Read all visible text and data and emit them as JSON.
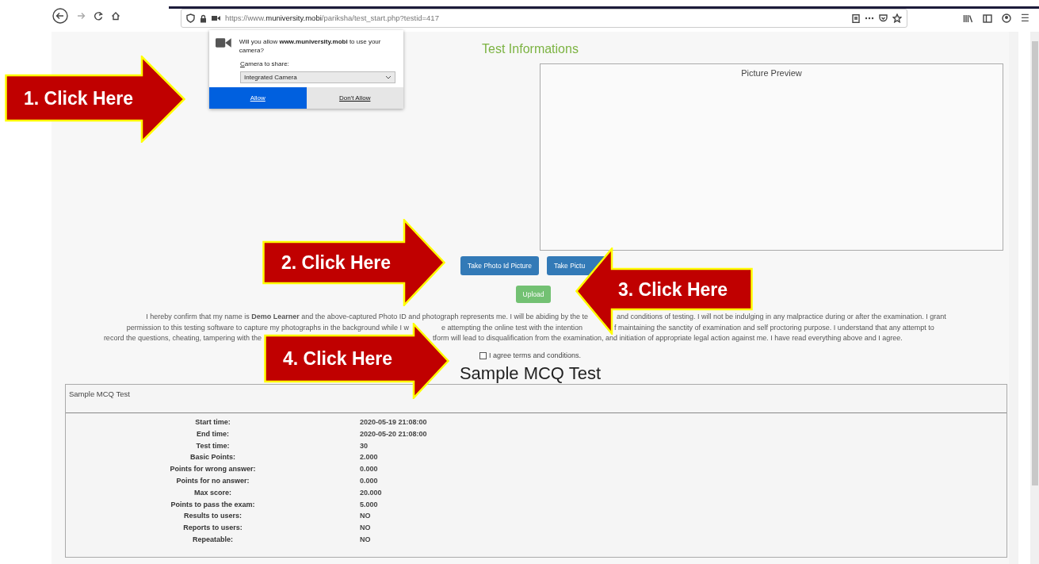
{
  "browser": {
    "url": {
      "prefix": "https://www.",
      "domain": "muniversity.mobi",
      "path": "/pariksha/test_start.php?testid=417"
    },
    "menu_glyph": "☰"
  },
  "camera_prompt": {
    "message": "Will you allow **www.muniversity.mobi** to use your camera?",
    "select_label": "Camera to share:",
    "selected_option": "Integrated Camera",
    "buttons": [
      {
        "label": "Allow",
        "kind": "primary"
      },
      {
        "label": "Don't Allow",
        "kind": "secondary"
      }
    ]
  },
  "page": {
    "title": "Test Informations",
    "preview_label": "Picture Preview",
    "capture_buttons": [
      {
        "label": "Take Photo Id Picture",
        "kind": "primary"
      },
      {
        "label": "Take Pictu",
        "kind": "primary"
      }
    ],
    "upload_button": {
      "label": "Upload",
      "kind": "success"
    },
    "consent_lines": [
      [
        "I hereby confirm that my name is **Demo Learner** and the above-captured Photo ID and photograph represents me. I will be abiding by the te",
        "and conditions of testing. I will not be indulging in any malpractice during or after the examination. I grant"
      ],
      [
        "permission to this testing software to capture my photographs in the background while I w",
        "e attempting the online test with the intention",
        "f maintaining the sanctity of examination and self proctoring purpose. I understand that any attempt to"
      ],
      [
        "record the questions, cheating, tampering with the",
        "tform will lead to disqualification from the examination, and initiation of appropriate legal action against me. I have read everything above and I agree."
      ]
    ],
    "agree": {
      "label": "I agree terms and conditions.",
      "checked": false
    },
    "test_title": "Sample MCQ Test",
    "details": {
      "header": "Sample MCQ Test",
      "rows": [
        {
          "label": "Start time:",
          "value": "2020-05-19 21:08:00"
        },
        {
          "label": "End time:",
          "value": "2020-05-20 21:08:00"
        },
        {
          "label": "Test time:",
          "value": "30"
        },
        {
          "label": "Basic Points:",
          "value": "2.000"
        },
        {
          "label": "Points for wrong answer:",
          "value": "0.000"
        },
        {
          "label": "Points for no answer:",
          "value": "0.000"
        },
        {
          "label": "Max score:",
          "value": "20.000"
        },
        {
          "label": "Points to pass the exam:",
          "value": "5.000"
        },
        {
          "label": "Results to users:",
          "value": "NO"
        },
        {
          "label": "Reports to users:",
          "value": "NO"
        },
        {
          "label": "Repeatable:",
          "value": "NO"
        }
      ]
    }
  },
  "callouts": [
    {
      "label": "1. Click Here",
      "kind": "right"
    },
    {
      "label": "2. Click Here",
      "kind": "right"
    },
    {
      "label": "3. Click Here",
      "kind": "left"
    },
    {
      "label": "4. Click Here",
      "kind": "right"
    }
  ]
}
